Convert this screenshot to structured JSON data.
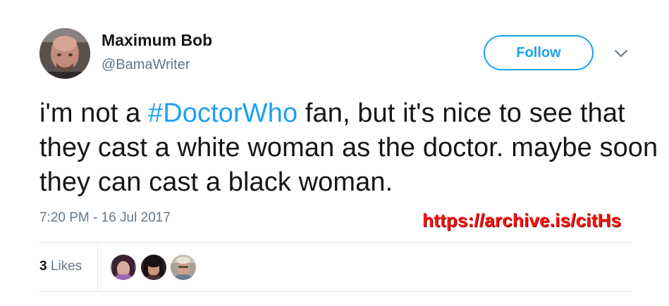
{
  "author": {
    "display_name": "Maximum Bob",
    "handle": "@BamaWriter",
    "avatar_icon": "profile-avatar"
  },
  "follow_button": {
    "label": "Follow",
    "color": "#1da1f2"
  },
  "menu_icon": "chevron-down-icon",
  "tweet": {
    "text_before": "i'm not a ",
    "hashtag": "#DoctorWho",
    "text_after": " fan, but it's nice to see that they cast a white woman as the doctor. maybe soon they can cast a black woman.",
    "timestamp": "7:20 PM - 16 Jul 2017"
  },
  "overlay": {
    "archive_url": "https://archive.is/citHs",
    "color": "#ff1010"
  },
  "engagement": {
    "likes_count": "3",
    "likes_label": "Likes",
    "likers": [
      "liker-avatar-1",
      "liker-avatar-2",
      "liker-avatar-3"
    ]
  },
  "colors": {
    "text": "#14171a",
    "secondary": "#657786",
    "link": "#1da1f2",
    "divider": "#e1e8ed"
  }
}
